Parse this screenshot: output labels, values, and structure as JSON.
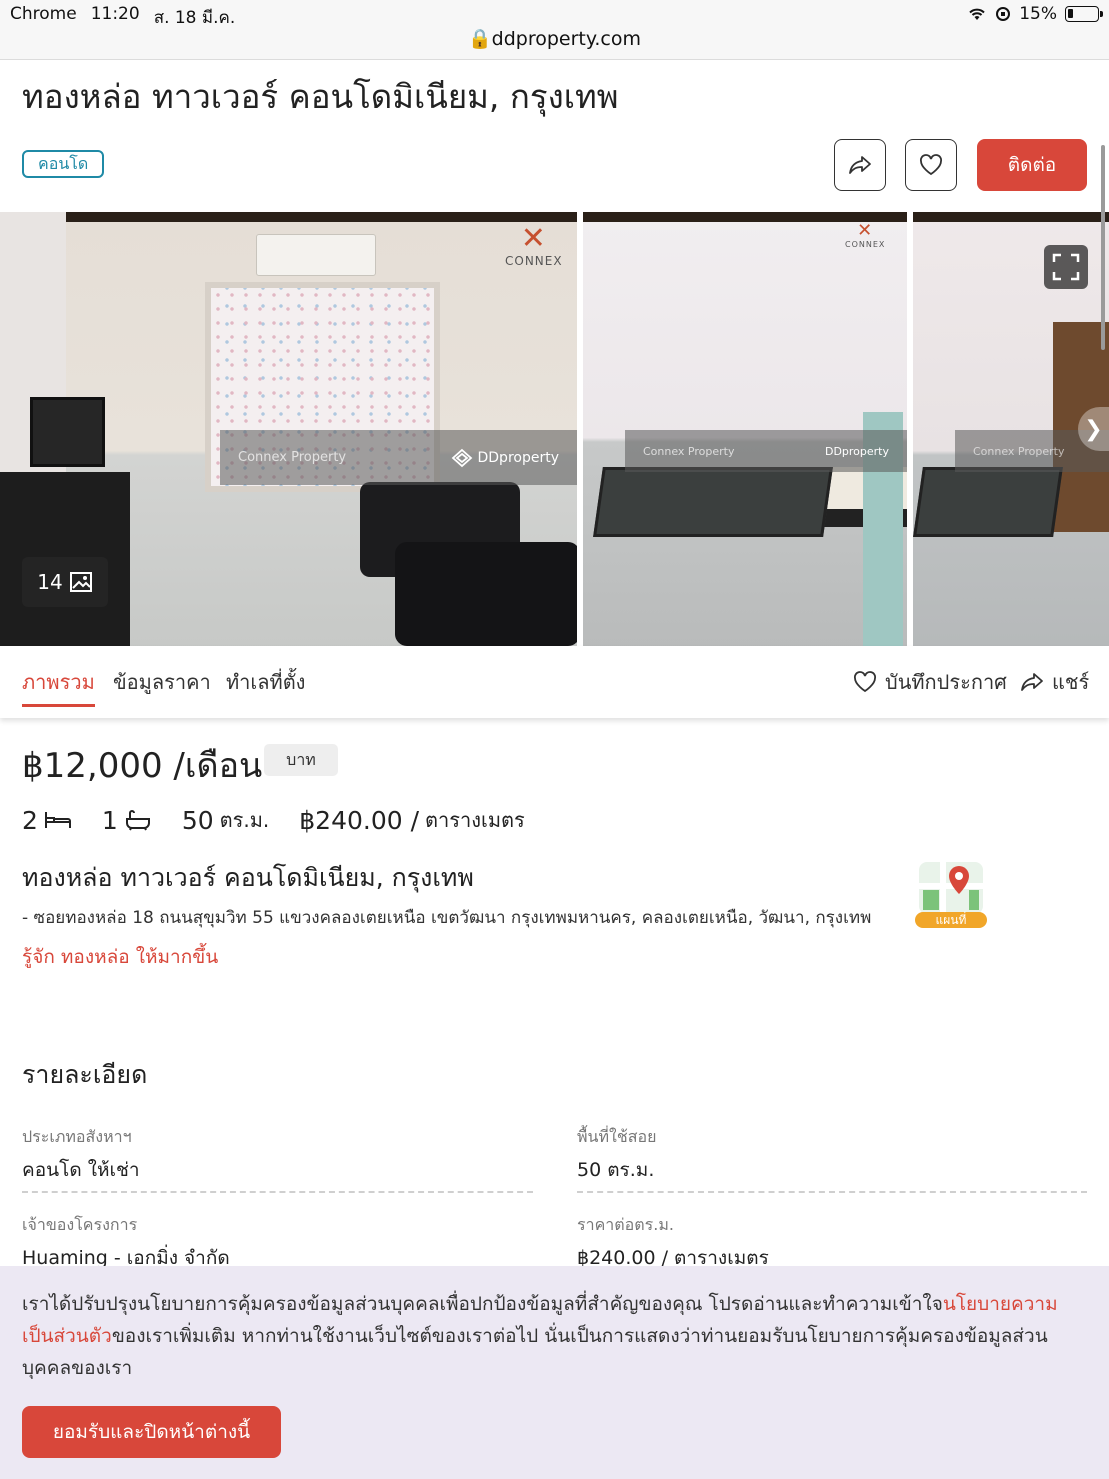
{
  "status_bar": {
    "app": "Chrome",
    "time": "11:20",
    "date": "ส. 18 มี.ค.",
    "battery": "15%",
    "url": "ddproperty.com"
  },
  "listing": {
    "title": "ทองหล่อ ทาวเวอร์ คอนโดมิเนียม, กรุงเทพ",
    "tag": "คอนโด",
    "contact_label": "ติดต่อ",
    "photo_count": "14",
    "watermarks": {
      "connex": "Connex Property",
      "ddproperty": "DDproperty",
      "logo": "CONNEX"
    },
    "tabs": [
      "ภาพรวม",
      "ข้อมูลราคา",
      "ทำเลที่ตั้ง"
    ],
    "save_label": "บันทึกประกาศ",
    "share_label": "แชร์",
    "price": "฿12,000 /เดือน",
    "currency": "บาท",
    "beds": "2",
    "baths": "1",
    "area": "50",
    "area_unit": "ตร.ม.",
    "price_per_sqm": "฿240.00 /",
    "price_per_sqm_unit": "ตารางเมตร",
    "address_title": "ทองหล่อ ทาวเวอร์ คอนโดมิเนียม, กรุงเทพ",
    "address": "- ซอยทองหล่อ 18 ถนนสุขุมวิท 55 แขวงคลองเตยเหนือ เขตวัฒนา กรุงเทพมหานคร, คลองเตยเหนือ, วัฒนา, กรุงเทพ",
    "know_more": "รู้จัก ทองหล่อ ให้มากขึ้น",
    "map_label": "แผนที่"
  },
  "details": {
    "heading": "รายละเอียด",
    "items": [
      {
        "label": "ประเภทอสังหาฯ",
        "value": "คอนโด ให้เช่า"
      },
      {
        "label": "พื้นที่ใช้สอย",
        "value": "50 ตร.ม."
      },
      {
        "label": "เจ้าของโครงการ",
        "value": "Huaming - เอกมิ่ง จำกัด"
      },
      {
        "label": "ราคาต่อตร.ม.",
        "value": "฿240.00 / ตารางเมตร"
      }
    ]
  },
  "cookie": {
    "text_before": "เราได้ปรับปรุงนโยบายการคุ้มครองข้อมูลส่วนบุคคลเพื่อปกป้องข้อมูลที่สำคัญของคุณ โปรดอ่านและทำความเข้าใจ",
    "link": "นโยบายความเป็นส่วนตัว",
    "text_after": "ของเราเพิ่มเติม หากท่านใช้งานเว็บไซต์ของเราต่อไป นั่นเป็นการแสดงว่าท่านยอมรับนโยบายการคุ้มครองข้อมูลส่วนบุคคลของเรา",
    "accept": "ยอมรับและปิดหน้าต่างนี้"
  },
  "colors": {
    "accent": "#d8473a",
    "tag": "#1f8aa6"
  }
}
